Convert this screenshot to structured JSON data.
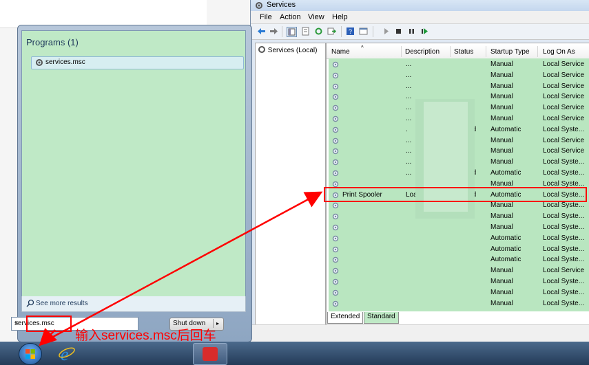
{
  "services_window": {
    "title": "Services",
    "menu": [
      "File",
      "Action",
      "View",
      "Help"
    ],
    "tree_item": "Services (Local)",
    "columns": [
      "Name",
      "Description",
      "Status",
      "Startup Type",
      "Log On As"
    ],
    "rows": [
      {
        "name": "",
        "description": "...",
        "status": "",
        "startup": "Manual",
        "logon": "Local Service"
      },
      {
        "name": "",
        "description": "...",
        "status": "",
        "startup": "Manual",
        "logon": "Local Service"
      },
      {
        "name": "",
        "description": "...",
        "status": "",
        "startup": "Manual",
        "logon": "Local Service"
      },
      {
        "name": "",
        "description": "...",
        "status": "",
        "startup": "Manual",
        "logon": "Local Service"
      },
      {
        "name": "",
        "description": "...",
        "status": "",
        "startup": "Manual",
        "logon": "Local Service"
      },
      {
        "name": "",
        "description": "...",
        "status": "",
        "startup": "Manual",
        "logon": "Local Service"
      },
      {
        "name": "",
        "description": ".",
        "status": "Started",
        "startup": "Automatic",
        "logon": "Local Syste..."
      },
      {
        "name": "",
        "description": "...",
        "status": "",
        "startup": "Manual",
        "logon": "Local Service"
      },
      {
        "name": "",
        "description": "...",
        "status": "",
        "startup": "Manual",
        "logon": "Local Service"
      },
      {
        "name": "",
        "description": "...",
        "status": "",
        "startup": "Manual",
        "logon": "Local Syste..."
      },
      {
        "name": "",
        "description": "...",
        "status": "Started",
        "startup": "Automatic",
        "logon": "Local Syste..."
      },
      {
        "name": "",
        "description": "",
        "status": "",
        "startup": "Manual",
        "logon": "Local Syste..."
      },
      {
        "name": "Print Spooler",
        "description": "Loads files t...",
        "status": "Started",
        "startup": "Automatic",
        "logon": "Local Syste..."
      },
      {
        "name": "",
        "description": "",
        "status": "",
        "startup": "Manual",
        "logon": "Local Syste..."
      },
      {
        "name": "",
        "description": "",
        "status": "",
        "startup": "Manual",
        "logon": "Local Syste..."
      },
      {
        "name": "",
        "description": "",
        "status": "",
        "startup": "Manual",
        "logon": "Local Syste..."
      },
      {
        "name": "",
        "description": "",
        "status": "",
        "startup": "Automatic",
        "logon": "Local Syste..."
      },
      {
        "name": "",
        "description": "",
        "status": "",
        "startup": "Automatic",
        "logon": "Local Syste..."
      },
      {
        "name": "",
        "description": "",
        "status": "",
        "startup": "Automatic",
        "logon": "Local Syste..."
      },
      {
        "name": "",
        "description": "",
        "status": "",
        "startup": "Manual",
        "logon": "Local Service"
      },
      {
        "name": "",
        "description": "",
        "status": "",
        "startup": "Manual",
        "logon": "Local Syste..."
      },
      {
        "name": "",
        "description": "",
        "status": "",
        "startup": "Manual",
        "logon": "Local Syste..."
      },
      {
        "name": "",
        "description": "",
        "status": "",
        "startup": "Manual",
        "logon": "Local Syste..."
      }
    ],
    "tabs": [
      "Extended",
      "Standard"
    ]
  },
  "start_menu": {
    "programs_header": "Programs (1)",
    "program_item": "services.msc",
    "see_more": "See more results",
    "search_value": "services.msc",
    "clear_icon": "×",
    "shutdown_label": "Shut down",
    "shutdown_arrow": "▸"
  },
  "annotation": {
    "caption": "输入services.msc后回车",
    "color": "#ff0000"
  },
  "taskbar": {
    "items": [
      "start-orb",
      "internet-explorer-icon",
      "toolbox-icon"
    ]
  }
}
